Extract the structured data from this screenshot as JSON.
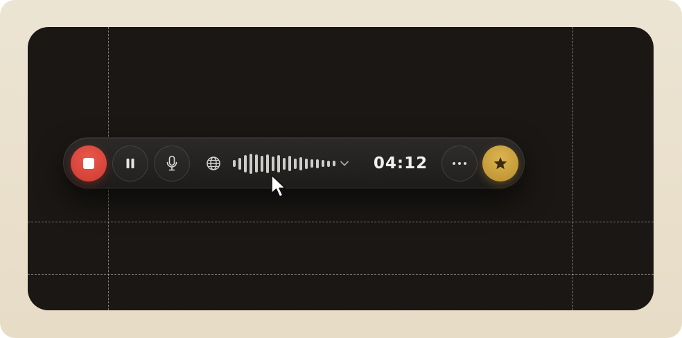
{
  "recorder": {
    "timer": "04:12",
    "state": "recording",
    "waveform_levels": [
      0.34,
      0.6,
      0.86,
      1.0,
      0.9,
      0.8,
      0.94,
      0.72,
      0.86,
      0.6,
      0.76,
      0.52,
      0.64,
      0.52,
      0.4,
      0.46,
      0.34,
      0.3,
      0.26
    ]
  },
  "icons": {
    "stop": "stop-icon",
    "pause": "pause-icon",
    "microphone": "microphone-icon",
    "language": "globe-icon",
    "expand": "chevron-down-icon",
    "more": "more-horizontal-icon",
    "favorite": "star-icon",
    "pointer": "mouse-cursor-icon"
  },
  "colors": {
    "stop_button": "#d8433a",
    "star_button": "#c9a03e",
    "toolbar": "#252321",
    "canvas": "#1a1714",
    "frame": "#ebe3d2"
  }
}
